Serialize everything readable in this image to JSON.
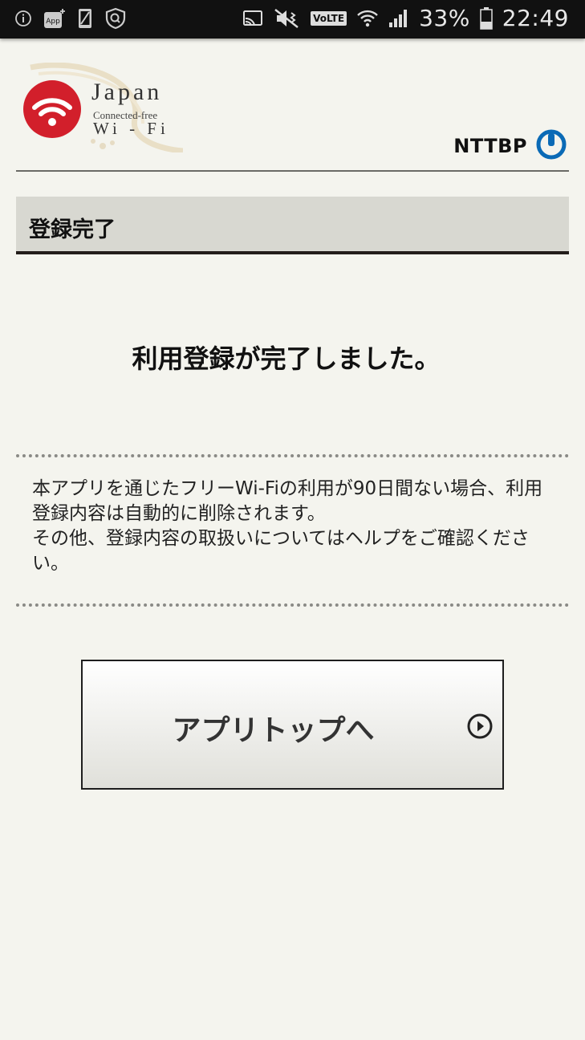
{
  "status_bar": {
    "battery_percent": "33%",
    "time": "22:49",
    "volte_label": "VoLTE",
    "app_badge": "App",
    "icons_left": [
      "info-icon",
      "app-icon",
      "phone-icon",
      "security-icon"
    ],
    "icons_right": [
      "cast-icon",
      "mute-icon",
      "volte-icon",
      "wifi-icon",
      "signal-icon",
      "battery-icon"
    ]
  },
  "header": {
    "logo_line1": "Japan",
    "logo_line2": "Connected-free",
    "logo_line3": "Wi - Fi",
    "logo_color": "#d21f2b",
    "provider": "NTTBP",
    "provider_color": "#0a6ab6"
  },
  "section": {
    "title": "登録完了"
  },
  "main": {
    "headline": "利用登録が完了しました。",
    "notice_line1": "本アプリを通じたフリーWi-Fiの利用が90日間ない場合、利用登録内容は自動的に削除されます。",
    "notice_line2": "その他、登録内容の取扱いについてはヘルプをご確認ください。"
  },
  "button": {
    "label": "アプリトップへ",
    "icon": "play-circle-icon"
  }
}
